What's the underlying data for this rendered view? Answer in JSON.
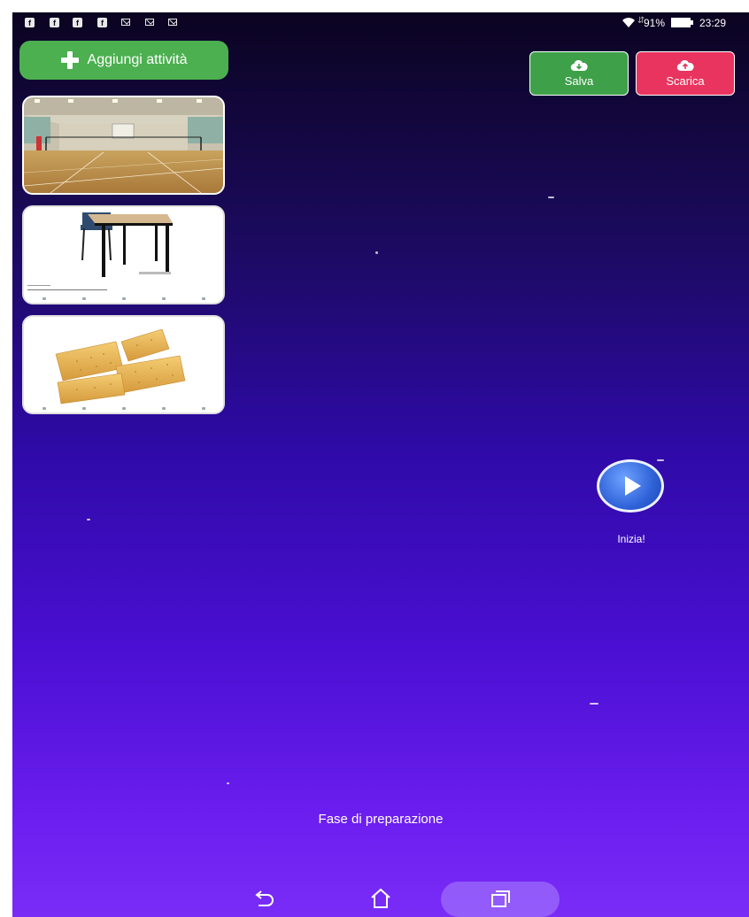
{
  "status_bar": {
    "battery_percent": "91%",
    "time": "23:29",
    "notification_icons": [
      "facebook-icon",
      "facebook-icon",
      "facebook-icon",
      "facebook-icon",
      "gmail-icon",
      "mail-icon",
      "mail-icon"
    ]
  },
  "toolbar": {
    "add_activity_label": "Aggiungi attività",
    "save_label": "Salva",
    "download_label": "Scarica"
  },
  "activities": [
    {
      "image": "gym-hall-photo"
    },
    {
      "image": "school-desk-photo"
    },
    {
      "image": "crackers-photo"
    }
  ],
  "start": {
    "label": "Inizia!"
  },
  "phase_label": "Fase di preparazione",
  "colors": {
    "add_button": "#4caf50",
    "save_button": "#3fa04a",
    "download_button": "#e8345e",
    "play_button": "#2f62d8"
  },
  "nav_bar": {
    "icons": [
      "back-icon",
      "home-icon",
      "recents-icon"
    ]
  }
}
